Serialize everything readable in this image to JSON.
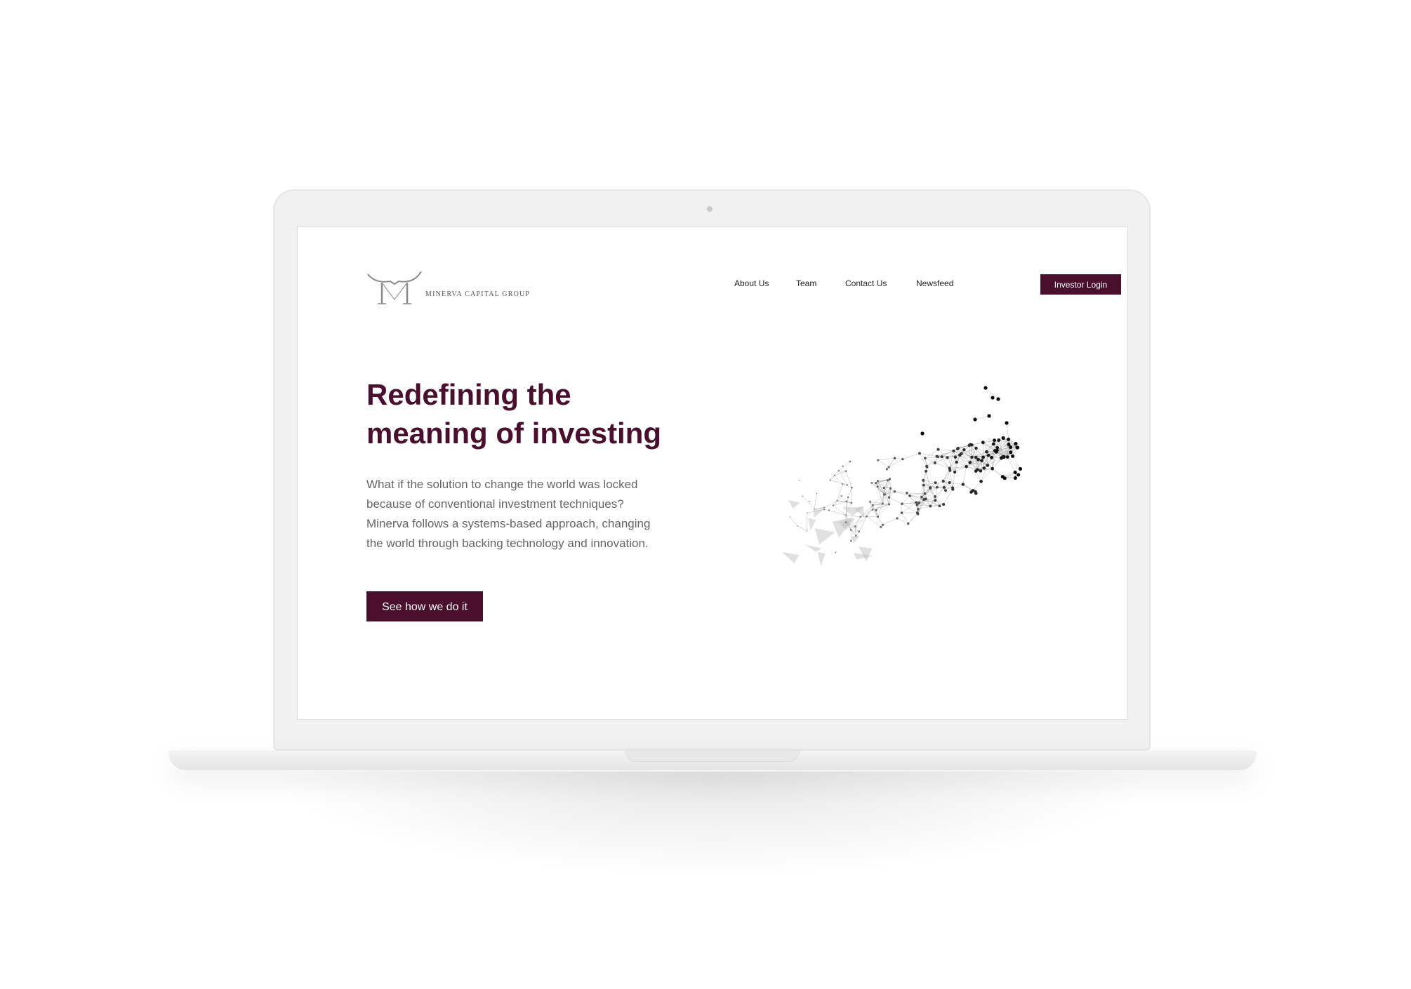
{
  "brand": {
    "name": "MINERVA CAPITAL GROUP",
    "color": "#4a0f2c"
  },
  "nav": {
    "items": [
      "About Us",
      "Team",
      "Contact Us",
      "Newsfeed"
    ],
    "login_label": "Investor Login"
  },
  "hero": {
    "headline_line1": "Redefining the",
    "headline_line2": "meaning of investing",
    "body_lines": [
      "What if the solution to change the world was locked",
      "because of conventional investment techniques?",
      "Minerva follows a systems-based approach, changing",
      "the world through backing technology and innovation."
    ],
    "cta_label": "See how we do it",
    "illustration": "network-particles"
  }
}
